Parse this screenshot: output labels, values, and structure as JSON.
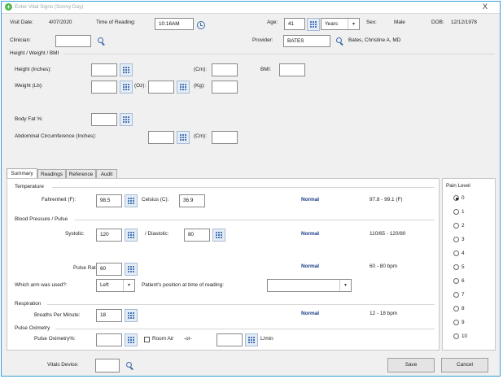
{
  "window": {
    "title": "Enter Vital Signs (Sonny Day)",
    "close_label": "X"
  },
  "header": {
    "visit_date_label": "Visit Date:",
    "visit_date": "4/07/2020",
    "time_label": "Time of Reading:",
    "time": "10:16AM",
    "age_label": "Age:",
    "age": "41",
    "age_unit": "Years",
    "sex_label": "Sex:",
    "sex": "Male",
    "dob_label": "DOB:",
    "dob": "12/12/1978",
    "clinician_label": "Clinician:",
    "clinician": "",
    "provider_label": "Provider:",
    "provider_code": "BATES",
    "provider_name": "Bates, Christine A, MD"
  },
  "hwbmi": {
    "section_label": "Height / Weight / BMI",
    "height_label": "Height (Inches):",
    "cm_label": "(Cm):",
    "bmi_label": "BMI:",
    "weight_label": "Weight (Lb):",
    "oz_label": "(Oz):",
    "kg_label": "(Kg):",
    "bodyfat_label": "Body Fat %:",
    "abdominal_label": "Abdominal Circumference (Inches):",
    "abd_cm_label": "(Cm):"
  },
  "tabs": [
    "Summary",
    "Readings",
    "Reference",
    "Audit"
  ],
  "summary": {
    "temperature": {
      "section": "Temperature",
      "f_label": "Fahrenheit (F):",
      "f_value": "98.5",
      "c_label": "Celsius (C):",
      "c_value": "36.9",
      "status": "Normal",
      "range": "97.8 - 99.1 (F)"
    },
    "bp": {
      "section": "Blood Pressure / Pulse",
      "sys_label": "Systolic:",
      "sys_value": "120",
      "dia_label": "/ Diastolic:",
      "dia_value": "80",
      "status": "Normal",
      "range": "110/65 - 120/80",
      "pulse_label": "Pulse Rate:",
      "pulse_value": "60",
      "pulse_status": "Normal",
      "pulse_range": "60 - 80 bpm",
      "arm_label": "Which arm was used?:",
      "arm_value": "Left",
      "position_label": "Patient's position at time of reading:",
      "position_value": ""
    },
    "respiration": {
      "section": "Respiration",
      "label": "Breaths Per Minute:",
      "value": "18",
      "status": "Normal",
      "range": "12 - 18 bpm"
    },
    "pulse_ox": {
      "section": "Pulse Oximetry",
      "label": "Pulse Oximetry%:",
      "value": "",
      "room_air_label": "Room Air",
      "or_label": "-or-",
      "lmin_value": "",
      "lmin_label": "L/min"
    }
  },
  "pain": {
    "title": "Pain Level",
    "levels": [
      "0",
      "1",
      "2",
      "3",
      "4",
      "5",
      "6",
      "7",
      "8",
      "9",
      "10"
    ],
    "selected": "0"
  },
  "footer": {
    "vitals_device_label": "Vitals Device:",
    "vitals_device": "",
    "save_label": "Save",
    "cancel_label": "Cancel"
  }
}
